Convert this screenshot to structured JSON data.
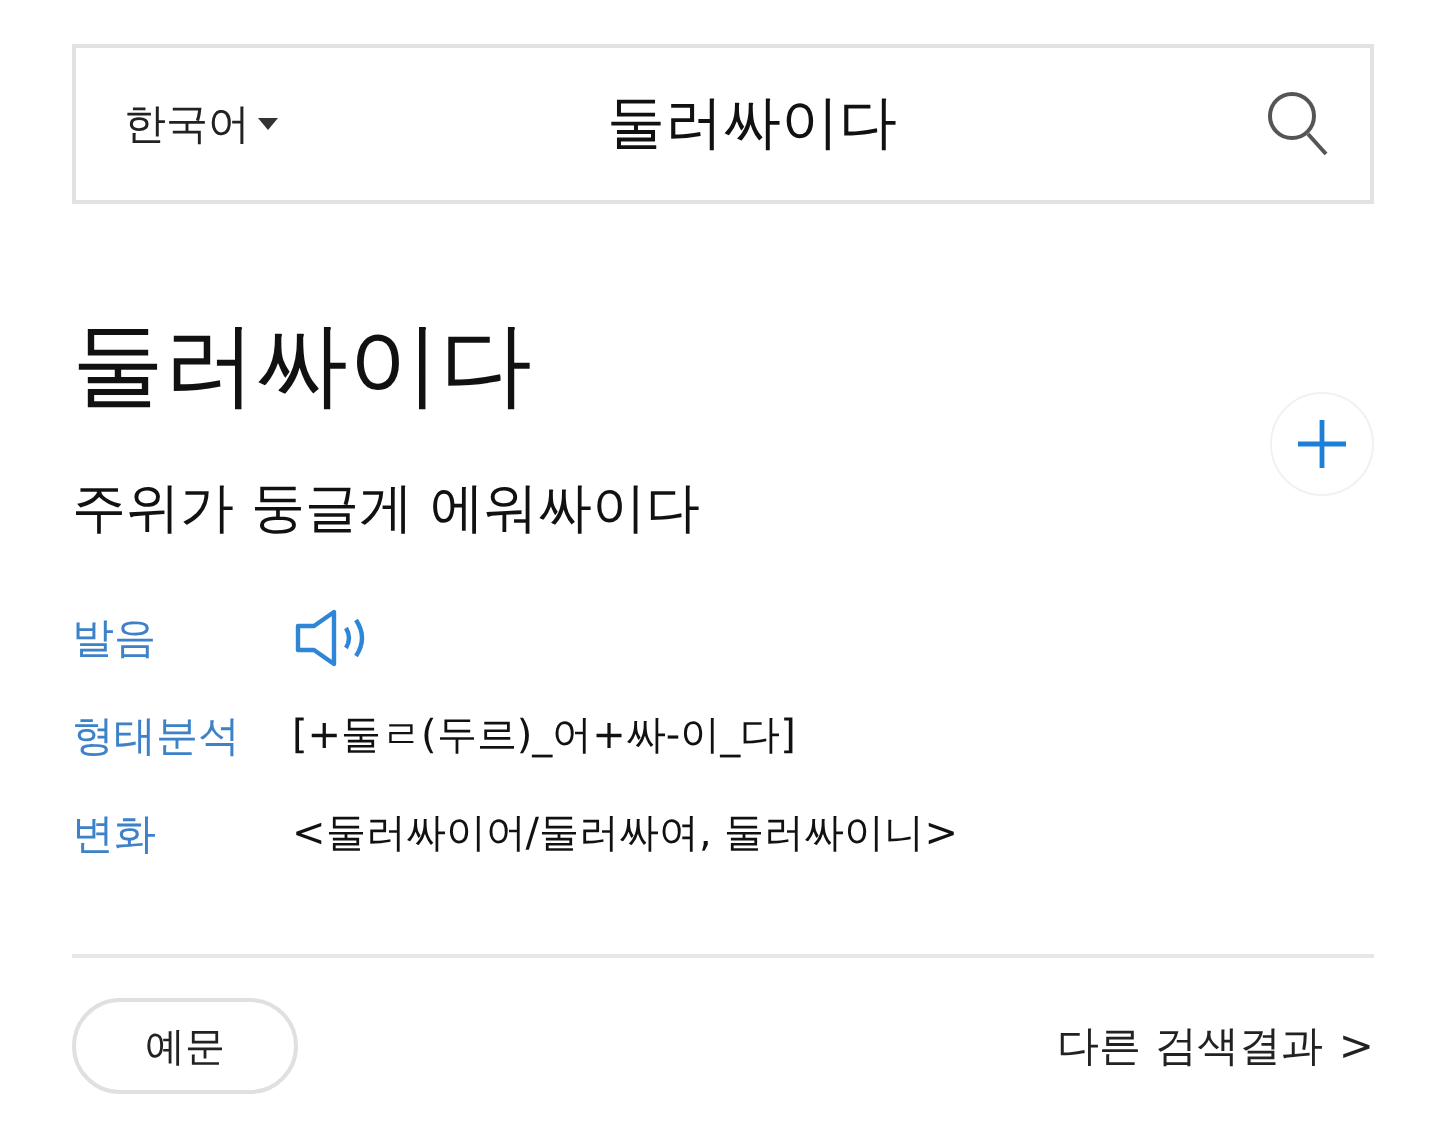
{
  "search": {
    "language": "한국어",
    "value": "둘러싸이다"
  },
  "entry": {
    "headword": "둘러싸이다",
    "definition": "주위가 둥글게 에워싸이다"
  },
  "rows": [
    {
      "kind": "audio",
      "label": "발음"
    },
    {
      "kind": "text",
      "label": "형태분석",
      "value": "[+둘ㄹ(두르)_어+싸-이_다]"
    },
    {
      "kind": "text",
      "label": "변화",
      "value": "<둘러싸이어/둘러싸여, 둘러싸이니>"
    }
  ],
  "footer": {
    "button": "예문",
    "link": "다른 검색결과",
    "link_arrow": ">"
  }
}
